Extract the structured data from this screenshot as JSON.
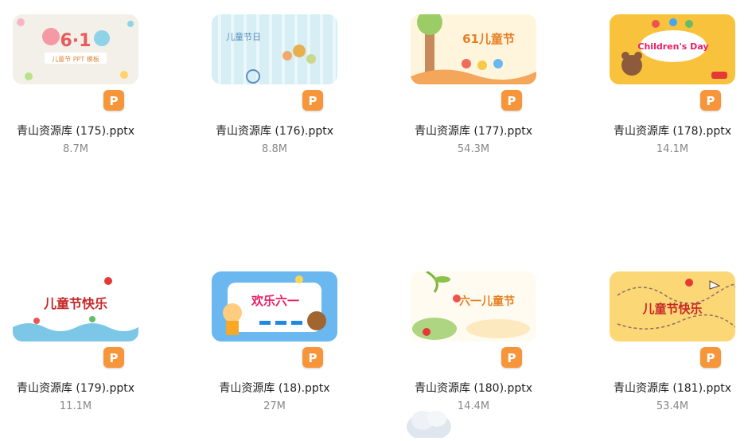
{
  "files": [
    {
      "name": "青山资源库 (175).pptx",
      "size": "8.7M",
      "thumb_text": "儿童节 PPT 模板",
      "thumb_title": "6·1",
      "thumb_color": "#f3f0ea",
      "icon": "pptx-file-icon"
    },
    {
      "name": "青山资源库 (176).pptx",
      "size": "8.8M",
      "thumb_text": "儿童节日",
      "thumb_title": "",
      "thumb_color": "#d6eef4",
      "icon": "pptx-file-icon"
    },
    {
      "name": "青山资源库 (177).pptx",
      "size": "54.3M",
      "thumb_text": "61儿童节",
      "thumb_title": "",
      "thumb_color": "#fff5dc",
      "icon": "pptx-file-icon"
    },
    {
      "name": "青山资源库 (178).pptx",
      "size": "14.1M",
      "thumb_text": "Children's Day",
      "thumb_title": "",
      "thumb_color": "#f9c23c",
      "icon": "pptx-file-icon"
    },
    {
      "name": "青山资源库 (179).pptx",
      "size": "11.1M",
      "thumb_text": "儿童节快乐",
      "thumb_title": "",
      "thumb_color": "#ffffff",
      "icon": "pptx-file-icon"
    },
    {
      "name": "青山资源库 (18).pptx",
      "size": "27M",
      "thumb_text": "欢乐六一",
      "thumb_title": "",
      "thumb_color": "#6ab8ef",
      "icon": "pptx-file-icon"
    },
    {
      "name": "青山资源库 (180).pptx",
      "size": "14.4M",
      "thumb_text": "六一儿童节",
      "thumb_title": "",
      "thumb_color": "#fffbf0",
      "icon": "pptx-file-icon"
    },
    {
      "name": "青山资源库 (181).pptx",
      "size": "53.4M",
      "thumb_text": "儿童节快乐",
      "thumb_title": "",
      "thumb_color": "#fcd776",
      "icon": "pptx-file-icon"
    }
  ],
  "accent": "#f7953a"
}
